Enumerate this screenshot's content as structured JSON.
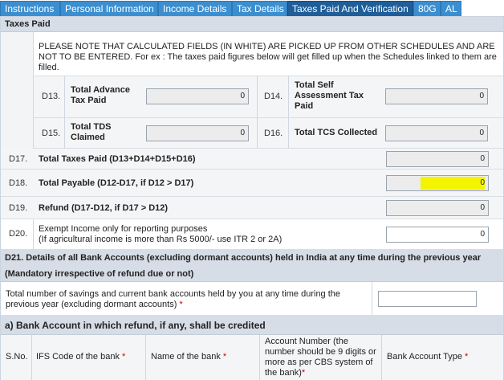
{
  "tabs": [
    {
      "label": "Instructions",
      "active": false
    },
    {
      "label": "Personal Information",
      "active": false
    },
    {
      "label": "Income Details",
      "active": false
    },
    {
      "label": "Tax Details",
      "active": false
    },
    {
      "label": "Taxes Paid And Verification",
      "active": true
    },
    {
      "label": "80G",
      "active": false
    },
    {
      "label": "AL",
      "active": false
    }
  ],
  "taxes_paid": {
    "heading": "Taxes Paid",
    "notice": "PLEASE NOTE THAT CALCULATED FIELDS (IN WHITE) ARE PICKED UP FROM OTHER SCHEDULES AND ARE NOT TO BE ENTERED. For ex : The taxes paid figures below will get filled up when the Schedules linked to them are filled.",
    "d13": {
      "code": "D13.",
      "label": "Total Advance Tax Paid",
      "value": "0"
    },
    "d14": {
      "code": "D14.",
      "label": "Total Self Assessment Tax Paid",
      "value": "0"
    },
    "d15": {
      "code": "D15.",
      "label": "Total TDS Claimed",
      "value": "0"
    },
    "d16": {
      "code": "D16.",
      "label": "Total TCS Collected",
      "value": "0"
    },
    "d17": {
      "code": "D17.",
      "label": "Total Taxes Paid (D13+D14+D15+D16)",
      "value": "0"
    },
    "d18": {
      "code": "D18.",
      "label": "Total Payable (D12-D17, if D12 > D17)",
      "value": "0"
    },
    "d19": {
      "code": "D19.",
      "label": "Refund (D17-D12, if D17 > D12)",
      "value": "0"
    },
    "d20": {
      "code": "D20.",
      "label_line1": "Exempt Income only for reporting purposes",
      "label_line2": "(If agricultural income is more than Rs 5000/- use ITR 2 or 2A)",
      "value": "0"
    }
  },
  "bank": {
    "heading": "D21. Details of all Bank Accounts (excluding dormant accounts) held in India at any time during the previous year (Mandatory irrespective of refund due or not)",
    "count_label": "Total number of savings and current bank accounts held by you at any time during the previous year (excluding dormant accounts)",
    "count_value": "",
    "refund_heading": "a) Bank Account in which refund, if any, shall be credited",
    "columns": {
      "sno": "S.No.",
      "ifsc": "IFS Code of the bank",
      "name": "Name of the bank",
      "account_number": "Account Number (the number should be 9 digits or more as per CBS system of the bank)",
      "account_type": "Bank Account Type"
    },
    "required_marker": "*"
  },
  "colors": {
    "tab": "#3b8fd0",
    "tab_active": "#1f5e99",
    "highlight": "#f4f400"
  }
}
